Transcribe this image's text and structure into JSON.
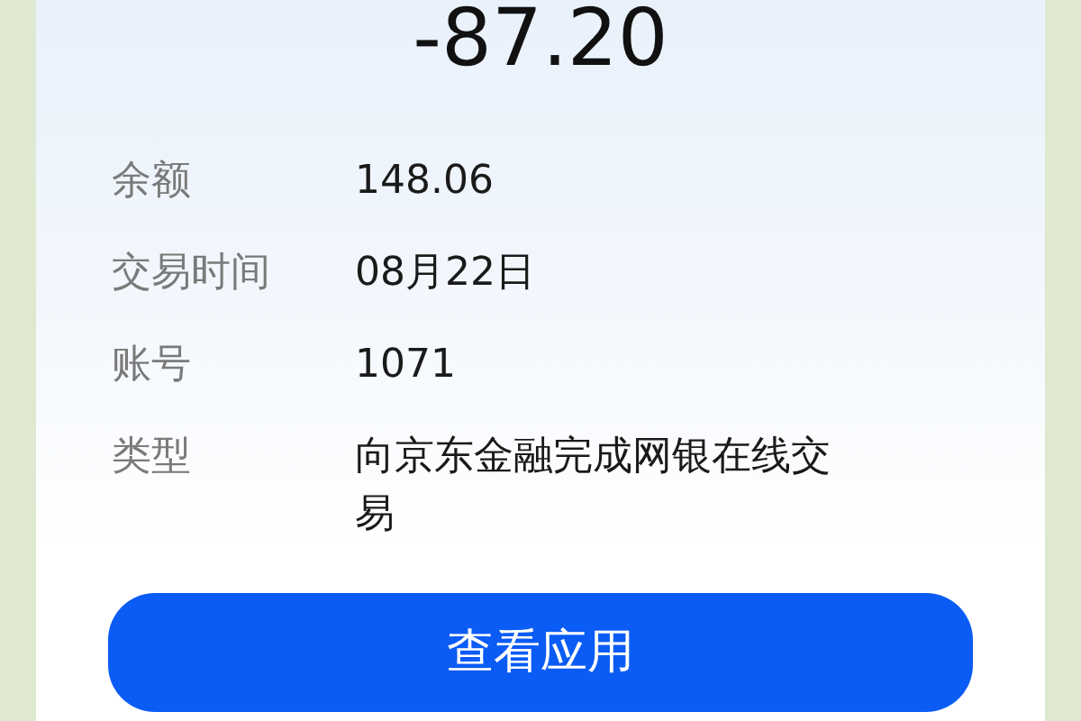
{
  "amount": "-87.20",
  "details": [
    {
      "label": "余额",
      "value": "148.06"
    },
    {
      "label": "交易时间",
      "value": "08月22日"
    },
    {
      "label": "账号",
      "value": "1071"
    },
    {
      "label": "类型",
      "value": "向京东金融完成网银在线交易"
    }
  ],
  "button": "查看应用"
}
